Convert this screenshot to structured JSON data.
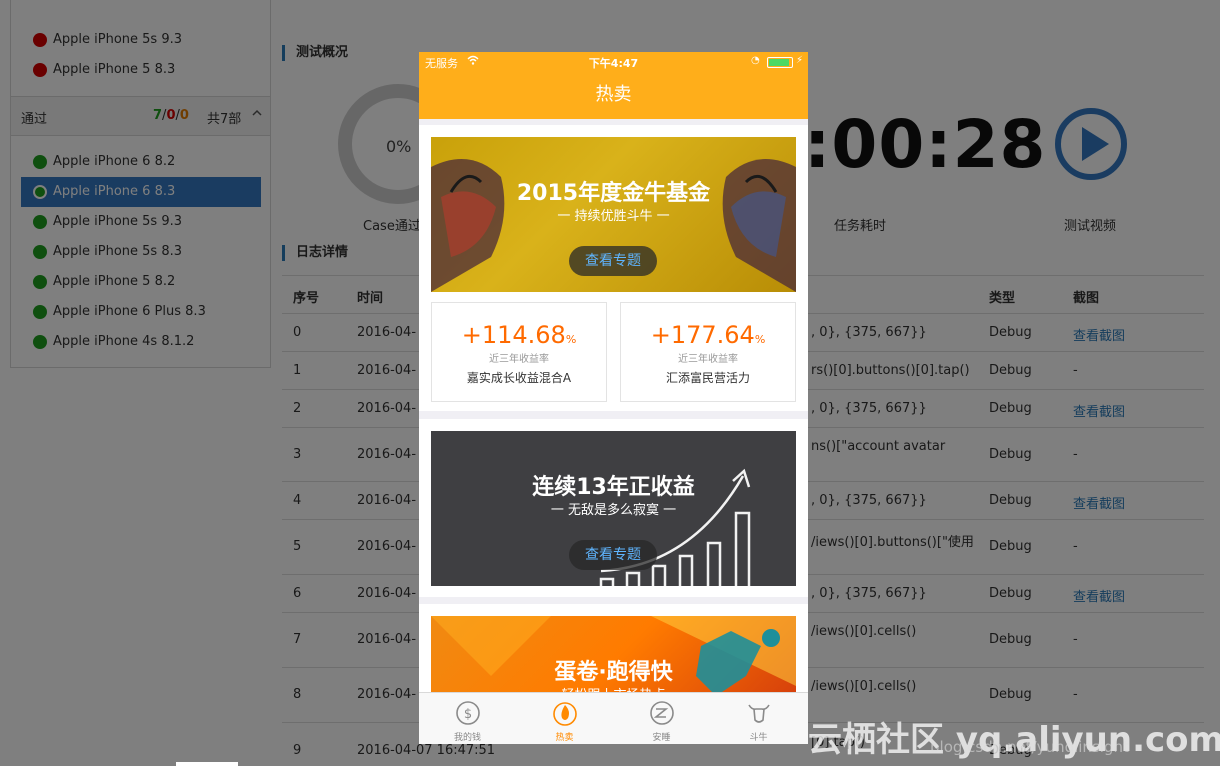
{
  "devices_top": [
    {
      "prefix": "Apple ",
      "model": "iPhone 5s",
      "ver": " 9.3",
      "status": "red"
    },
    {
      "prefix": "Apple ",
      "model": "iPhone 5",
      "ver": " 8.3",
      "status": "red"
    }
  ],
  "group": {
    "name": "通过",
    "pass": "7",
    "fail": "0",
    "other": "0",
    "total": "共7部",
    "chevron": "chevron-up"
  },
  "devices": [
    {
      "prefix": "Apple ",
      "model": "iPhone 6",
      "ver": " 8.2"
    },
    {
      "prefix": "Apple ",
      "model": "iPhone 6",
      "ver": " 8.3"
    },
    {
      "prefix": "Apple ",
      "model": "iPhone 5s",
      "ver": " 9.3"
    },
    {
      "prefix": "Apple ",
      "model": "iPhone 5s",
      "ver": " 8.3"
    },
    {
      "prefix": "Apple ",
      "model": "iPhone 5",
      "ver": " 8.2"
    },
    {
      "prefix": "Apple ",
      "model": "iPhone 6 Plus",
      "ver": " 8.3"
    },
    {
      "prefix": "Apple ",
      "model": "iPhone 4s",
      "ver": " 8.1.2"
    }
  ],
  "selected_device_index": 1,
  "overview": {
    "title": "测试概况",
    "gauge_value": "0%",
    "case_label": "Case通过",
    "timer": ":00:28",
    "task_label": "任务耗时",
    "video_label": "测试视频"
  },
  "log": {
    "title": "日志详情",
    "headers": {
      "no": "序号",
      "time": "时间",
      "type": "类型",
      "shot": "截图"
    },
    "rows": [
      {
        "no": "0",
        "time": "2016-04-",
        "msg": ", 0}, {375, 667}}",
        "type": "Debug",
        "shot": "查看截图"
      },
      {
        "no": "1",
        "time": "2016-04-",
        "msg": "rs()[0].buttons()[0].tap()",
        "type": "Debug",
        "shot": "-"
      },
      {
        "no": "2",
        "time": "2016-04-",
        "msg": ", 0}, {375, 667}}",
        "type": "Debug",
        "shot": "查看截图"
      },
      {
        "no": "3",
        "time": "2016-04-",
        "msg": "ns()[\"account avatar",
        "type": "Debug",
        "shot": "-"
      },
      {
        "no": "4",
        "time": "2016-04-",
        "msg": ", 0}, {375, 667}}",
        "type": "Debug",
        "shot": "查看截图"
      },
      {
        "no": "5",
        "time": "2016-04-",
        "msg": "/iews()[0].buttons()[\"使用",
        "type": "Debug",
        "shot": "-"
      },
      {
        "no": "6",
        "time": "2016-04-",
        "msg": ", 0}, {375, 667}}",
        "type": "Debug",
        "shot": "查看截图"
      },
      {
        "no": "7",
        "time": "2016-04-",
        "msg": "/iews()[0].cells()",
        "type": "Debug",
        "shot": "-"
      },
      {
        "no": "8",
        "time": "2016-04-",
        "msg": "/iews()[0].cells()",
        "type": "Debug",
        "shot": "-"
      },
      {
        "no": "9",
        "time": "2016-04-07 16:47:51",
        "msg": "[0].tap()",
        "type": "Debug",
        "shot": ""
      }
    ]
  },
  "phone": {
    "carrier": "无服务",
    "clock": "下午4:47",
    "title": "热卖",
    "banner1": {
      "title": "2015年度金牛基金",
      "subtitle": "一 持续优胜斗牛 一",
      "button": "查看专题"
    },
    "funds": [
      {
        "pct": "+114.68",
        "unit": "%",
        "label": "近三年收益率",
        "name": "嘉实成长收益混合A"
      },
      {
        "pct": "+177.64",
        "unit": "%",
        "label": "近三年收益率",
        "name": "汇添富民营活力"
      }
    ],
    "banner2": {
      "title": "连续13年正收益",
      "subtitle": "一 无敌是多么寂寞 一",
      "button": "查看专题"
    },
    "banner3": {
      "title": "蛋卷·跑得快",
      "subtitle": "一 轻松跟上市场热点 一"
    },
    "tabs": [
      {
        "label": "我的钱",
        "icon": "money-icon"
      },
      {
        "label": "热卖",
        "icon": "flame-icon"
      },
      {
        "label": "安睡",
        "icon": "sleep-icon"
      },
      {
        "label": "斗牛",
        "icon": "bull-icon"
      }
    ],
    "active_tab": 1
  },
  "watermark": {
    "main": "云栖社区 yq.aliyun.com",
    "sub": "blog.csdn.net/yunqiinsight"
  },
  "colors": {
    "accent": "#ffae1a",
    "link": "#2a7ab9",
    "pass": "#1e9e1e",
    "fail": "#d40000",
    "fund_up": "#ff6a00"
  }
}
